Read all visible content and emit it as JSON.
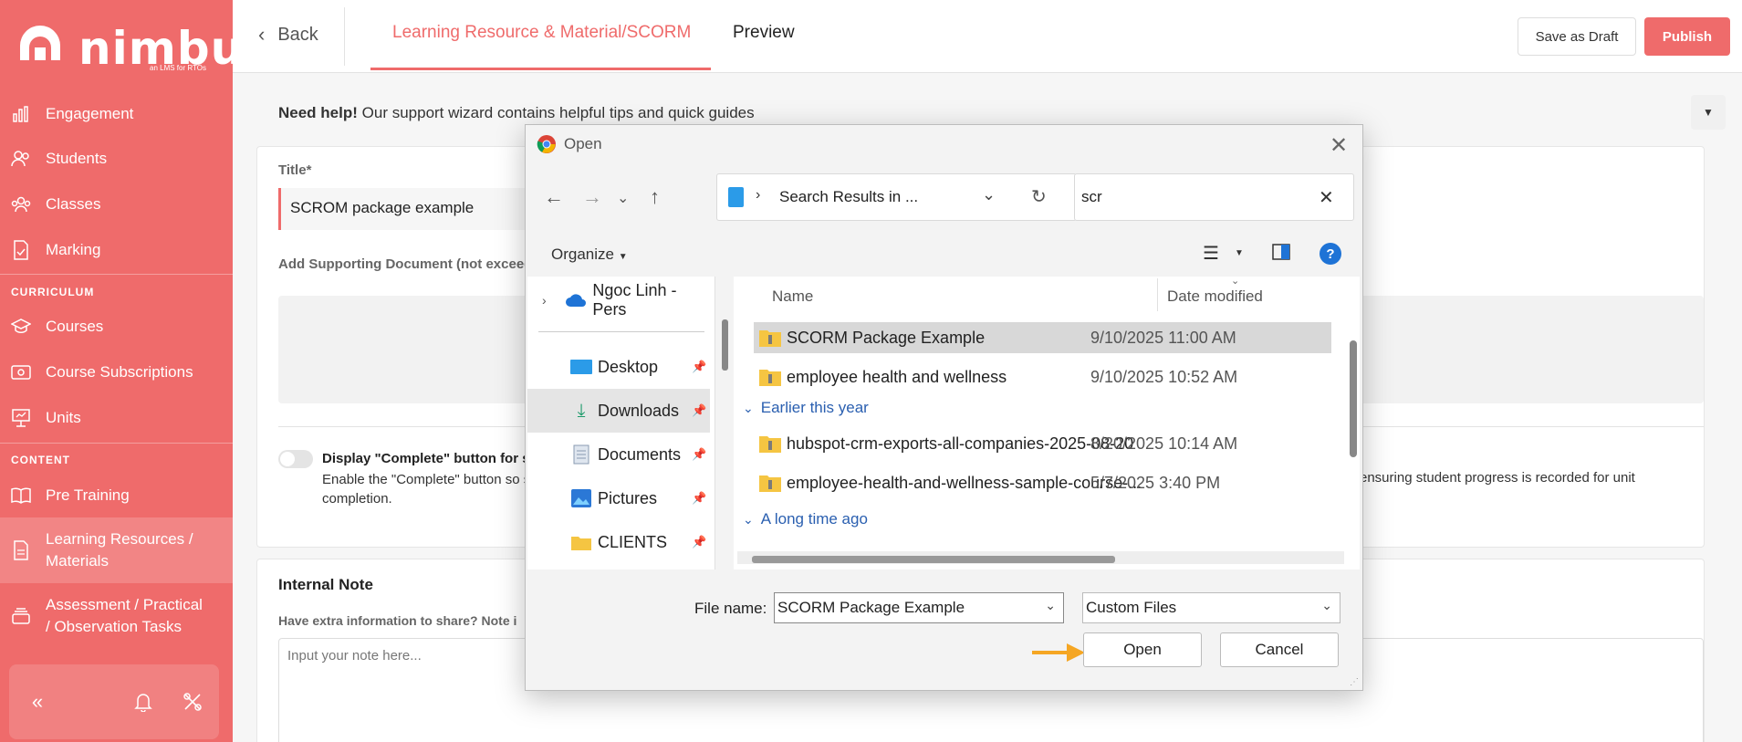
{
  "brand": {
    "name": "nimbu",
    "tagline": "an LMS for RTOs"
  },
  "sidebar": {
    "items": [
      {
        "label": "Engagement"
      },
      {
        "label": "Students"
      },
      {
        "label": "Classes"
      },
      {
        "label": "Marking"
      }
    ],
    "curriculum_label": "CURRICULUM",
    "curriculum_items": [
      {
        "label": "Courses"
      },
      {
        "label": "Course Subscriptions"
      },
      {
        "label": "Units"
      }
    ],
    "content_label": "CONTENT",
    "content_items": [
      {
        "label": "Pre Training"
      },
      {
        "label": "Learning Resources / Materials"
      },
      {
        "label": "Assessment / Practical / Observation Tasks"
      }
    ]
  },
  "topbar": {
    "back_label": "Back",
    "tabs": [
      {
        "label": "Learning Resource & Material/SCORM"
      },
      {
        "label": "Preview"
      }
    ],
    "save_draft": "Save as Draft",
    "publish": "Publish"
  },
  "main": {
    "help_bold": "Need help!",
    "help_text": "Our support wizard contains helpful tips and quick guides",
    "title_label": "Title*",
    "title_value": "SCROM package example",
    "supporting_label": "Add Supporting Document (not exceedi",
    "option_title": "Display \"Complete\" button for s",
    "option_desc": "Enable the \"Complete\" button so s completion.",
    "option_desc_right": "ensuring student progress is recorded for unit",
    "note_title": "Internal Note",
    "note_desc": "Have extra information to share? Note i",
    "note_placeholder": "Input your note here..."
  },
  "dialog": {
    "title": "Open",
    "address": "Search Results in ...",
    "search_value": "scr",
    "organize": "Organize",
    "left_pane": [
      {
        "label": "Ngoc Linh - Pers"
      },
      {
        "label": "Desktop"
      },
      {
        "label": "Downloads"
      },
      {
        "label": "Documents"
      },
      {
        "label": "Pictures"
      },
      {
        "label": "CLIENTS"
      }
    ],
    "columns": {
      "name": "Name",
      "date": "Date modified"
    },
    "files": [
      {
        "name": "SCORM Package Example",
        "date": "9/10/2025 11:00 AM"
      },
      {
        "name": "employee health and wellness",
        "date": "9/10/2025 10:52 AM"
      }
    ],
    "group_earlier": "Earlier this year",
    "files_earlier": [
      {
        "name": "hubspot-crm-exports-all-companies-2025-08-20",
        "date": "8/20/2025 10:14 AM"
      },
      {
        "name": "employee-health-and-wellness-sample-course-...",
        "date": "5/7/2025 3:40 PM"
      }
    ],
    "group_long_ago": "A long time ago",
    "file_name_label": "File name:",
    "file_name_value": "SCORM Package Example",
    "file_type": "Custom Files",
    "open_btn": "Open",
    "cancel_btn": "Cancel"
  },
  "colors": {
    "accent": "#ef6b6b",
    "annotation_arrow": "#f5a623",
    "link_blue": "#2a5fb0"
  }
}
